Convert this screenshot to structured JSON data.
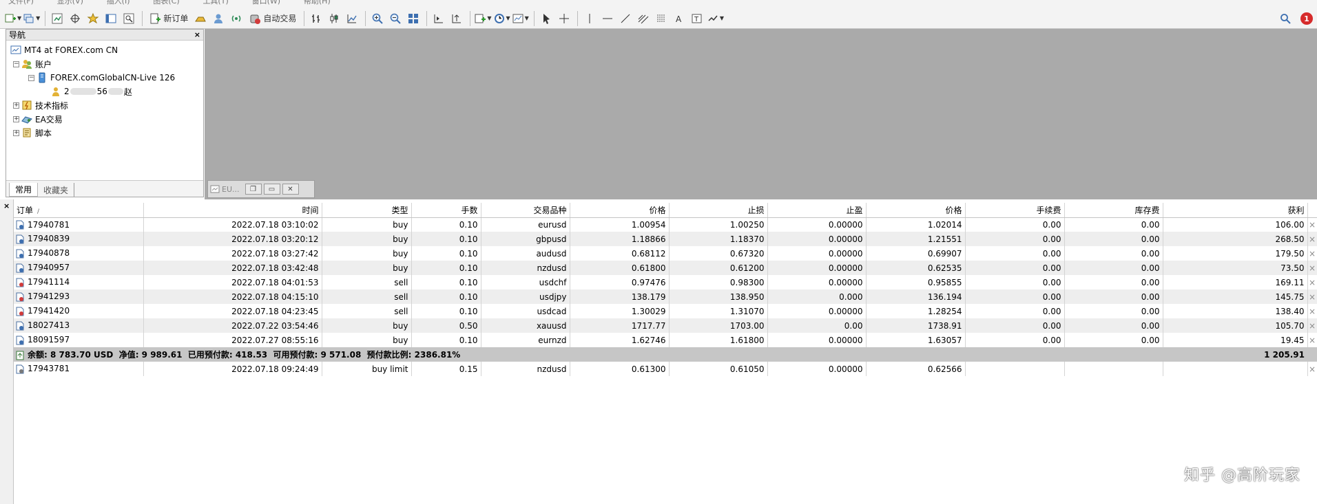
{
  "menu": [
    "文件(F)",
    "显示(V)",
    "插入(I)",
    "图表(C)",
    "工具(T)",
    "窗口(W)",
    "帮助(H)"
  ],
  "toolbar": {
    "new_order": "新订单",
    "auto_trading": "自动交易",
    "notification_count": "1"
  },
  "navigator": {
    "title": "导航",
    "root": "MT4 at FOREX.com CN",
    "accounts": "账户",
    "server": "FOREX.comGlobalCN-Live 126",
    "account_prefix": "2",
    "account_mid": "56",
    "account_suffix": "赵",
    "indicators": "技术指标",
    "experts": "EA交易",
    "scripts": "脚本",
    "tab_common": "常用",
    "tab_favorites": "收藏夹"
  },
  "minimized_chart": {
    "title": "EU..."
  },
  "terminal": {
    "columns": [
      "订单",
      "时间",
      "类型",
      "手数",
      "交易品种",
      "价格",
      "止损",
      "止盈",
      "价格",
      "手续费",
      "库存费",
      "获利"
    ],
    "sort_marker": "/",
    "close_glyph": "×",
    "rows": [
      {
        "order": "17940781",
        "time": "2022.07.18 03:10:02",
        "type": "buy",
        "lots": "0.10",
        "symbol": "eurusd",
        "price": "1.00954",
        "sl": "1.00250",
        "tp": "0.00000",
        "cur": "1.02014",
        "commission": "0.00",
        "swap": "0.00",
        "profit": "106.00"
      },
      {
        "order": "17940839",
        "time": "2022.07.18 03:20:12",
        "type": "buy",
        "lots": "0.10",
        "symbol": "gbpusd",
        "price": "1.18866",
        "sl": "1.18370",
        "tp": "0.00000",
        "cur": "1.21551",
        "commission": "0.00",
        "swap": "0.00",
        "profit": "268.50"
      },
      {
        "order": "17940878",
        "time": "2022.07.18 03:27:42",
        "type": "buy",
        "lots": "0.10",
        "symbol": "audusd",
        "price": "0.68112",
        "sl": "0.67320",
        "tp": "0.00000",
        "cur": "0.69907",
        "commission": "0.00",
        "swap": "0.00",
        "profit": "179.50"
      },
      {
        "order": "17940957",
        "time": "2022.07.18 03:42:48",
        "type": "buy",
        "lots": "0.10",
        "symbol": "nzdusd",
        "price": "0.61800",
        "sl": "0.61200",
        "tp": "0.00000",
        "cur": "0.62535",
        "commission": "0.00",
        "swap": "0.00",
        "profit": "73.50"
      },
      {
        "order": "17941114",
        "time": "2022.07.18 04:01:53",
        "type": "sell",
        "lots": "0.10",
        "symbol": "usdchf",
        "price": "0.97476",
        "sl": "0.98300",
        "tp": "0.00000",
        "cur": "0.95855",
        "commission": "0.00",
        "swap": "0.00",
        "profit": "169.11"
      },
      {
        "order": "17941293",
        "time": "2022.07.18 04:15:10",
        "type": "sell",
        "lots": "0.10",
        "symbol": "usdjpy",
        "price": "138.179",
        "sl": "138.950",
        "tp": "0.000",
        "cur": "136.194",
        "commission": "0.00",
        "swap": "0.00",
        "profit": "145.75"
      },
      {
        "order": "17941420",
        "time": "2022.07.18 04:23:45",
        "type": "sell",
        "lots": "0.10",
        "symbol": "usdcad",
        "price": "1.30029",
        "sl": "1.31070",
        "tp": "0.00000",
        "cur": "1.28254",
        "commission": "0.00",
        "swap": "0.00",
        "profit": "138.40"
      },
      {
        "order": "18027413",
        "time": "2022.07.22 03:54:46",
        "type": "buy",
        "lots": "0.50",
        "symbol": "xauusd",
        "price": "1717.77",
        "sl": "1703.00",
        "tp": "0.00",
        "cur": "1738.91",
        "commission": "0.00",
        "swap": "0.00",
        "profit": "105.70"
      },
      {
        "order": "18091597",
        "time": "2022.07.27 08:55:16",
        "type": "buy",
        "lots": "0.10",
        "symbol": "eurnzd",
        "price": "1.62746",
        "sl": "1.61800",
        "tp": "0.00000",
        "cur": "1.63057",
        "commission": "0.00",
        "swap": "0.00",
        "profit": "19.45"
      }
    ],
    "summary": {
      "text": "余额: 8 783.70 USD  净值: 9 989.61  已用预付款: 418.53  可用预付款: 9 571.08  预付款比例: 2386.81%",
      "total_profit": "1 205.91"
    },
    "pending": {
      "order": "17943781",
      "time": "2022.07.18 09:24:49",
      "type": "buy limit",
      "lots": "0.15",
      "symbol": "nzdusd",
      "price": "0.61300",
      "sl": "0.61050",
      "tp": "0.00000",
      "cur": "0.62566"
    }
  },
  "watermark": "知乎 @高阶玩家",
  "colors": {
    "workspace": "#aaaaaa",
    "summary_row": "#c6c6c6",
    "badge": "#d62b2b"
  }
}
